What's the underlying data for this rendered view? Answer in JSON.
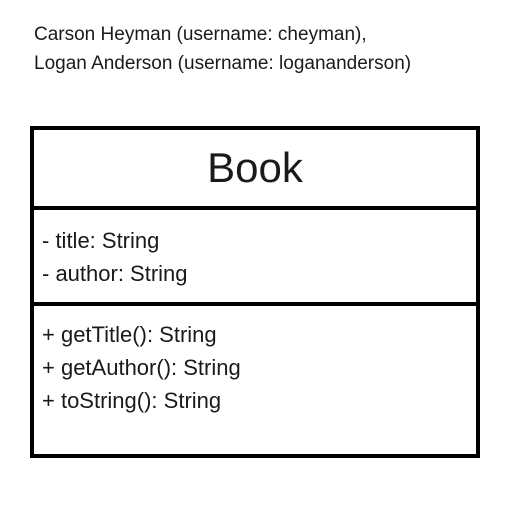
{
  "authors": {
    "line1": "Carson Heyman (username: cheyman),",
    "line2": "Logan Anderson (username: logananderson)"
  },
  "class_box": {
    "name": "Book",
    "attributes": [
      "- title: String",
      "- author: String"
    ],
    "methods": [
      "+ getTitle(): String",
      "+ getAuthor(): String",
      "+ toString(): String"
    ]
  }
}
